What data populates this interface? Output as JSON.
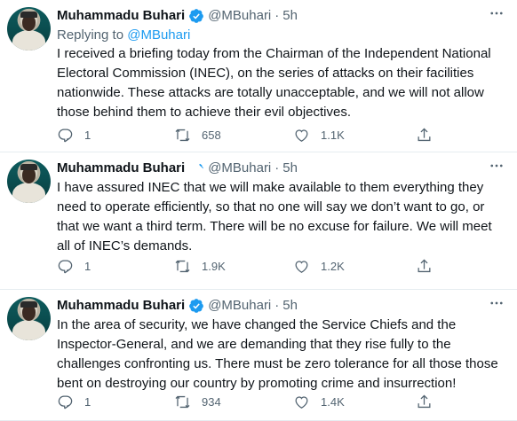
{
  "tweets": [
    {
      "author_name": "Muhammadu Buhari",
      "handle": "@MBuhari",
      "separator": "·",
      "time": "5h",
      "replying_prefix": "Replying to",
      "replying_handle": "@MBuhari",
      "text": "I received a briefing today from the Chairman of the Independent National Electoral Commission (INEC), on the series of attacks on their facilities nationwide. These attacks are totally unacceptable, and we will not allow those behind them to achieve their evil objectives.",
      "replies": "1",
      "retweets": "658",
      "likes": "1.1K"
    },
    {
      "author_name": "Muhammadu Buhari",
      "handle": "@MBuhari",
      "separator": "·",
      "time": "5h",
      "text": "I have assured INEC that we will make available to them everything they need to operate efficiently, so that no one will say we don’t want to go, or that we want a third term. There will be no excuse for failure. We will meet all of INEC’s demands.",
      "replies": "1",
      "retweets": "1.9K",
      "likes": "1.2K"
    },
    {
      "author_name": "Muhammadu Buhari",
      "handle": "@MBuhari",
      "separator": "·",
      "time": "5h",
      "text": "In the area of security, we have changed the Service Chiefs and the Inspector-General, and we are demanding that they rise fully to the challenges confronting us. There must be zero tolerance for all those those bent on destroying our country by promoting crime and insurrection!",
      "replies": "1",
      "retweets": "934",
      "likes": "1.4K"
    }
  ],
  "icons": {
    "verified": "verified-badge-icon",
    "more": "more-icon",
    "reply": "reply-icon",
    "retweet": "retweet-icon",
    "like": "like-icon",
    "share": "share-icon"
  },
  "colors": {
    "accent": "#1d9bf0",
    "secondary_text": "#536471",
    "divider": "#e6ecf0"
  }
}
